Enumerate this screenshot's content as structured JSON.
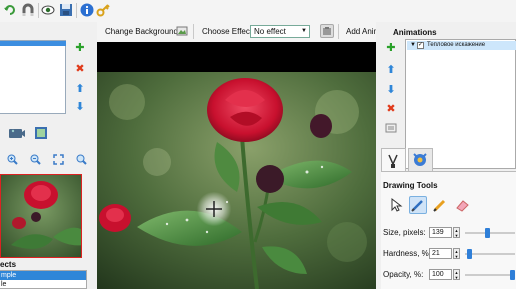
{
  "toolbar": {
    "icons": [
      "undo-icon",
      "magnet-icon",
      "eye-icon",
      "save-icon",
      "info-icon",
      "key-icon"
    ]
  },
  "left_panel": {
    "effects_label": "ects",
    "effects_items": [
      "mple",
      "le"
    ]
  },
  "effect_bar": {
    "change_background": "Change Background",
    "choose_effect": "Choose Effect:",
    "effect_value": "No effect",
    "add_anim": "Add Anim"
  },
  "right_panel": {
    "animations_title": "Animations",
    "animation_item": "Тепловое искажение",
    "drawing_tools_title": "Drawing Tools",
    "size_label": "Size, pixels:",
    "size_value": "139",
    "size_fraction": 0.45,
    "hardness_label": "Hardness, %:",
    "hardness_value": "21",
    "hardness_fraction": 0.05,
    "opacity_label": "Opacity, %:",
    "opacity_value": "100",
    "opacity_fraction": 1.0
  },
  "colors": {
    "accent": "#3c8ee0",
    "rose": "#c8102e",
    "leaf": "#2f6b2a"
  }
}
